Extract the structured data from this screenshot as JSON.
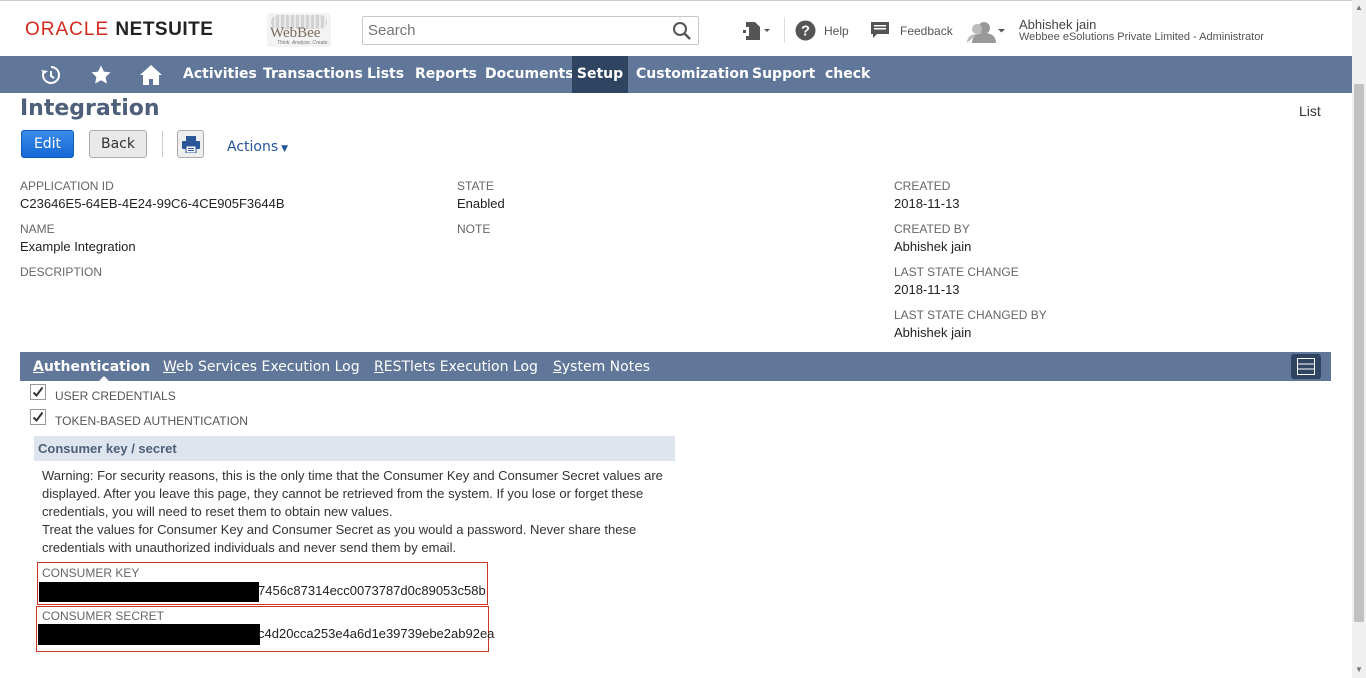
{
  "header": {
    "brand_left": "ORACLE",
    "brand_right": "NETSUITE",
    "partner_logo": "WebBee",
    "partner_tagline": "Think. Analyze. Create.",
    "search_placeholder": "Search",
    "help_label": "Help",
    "feedback_label": "Feedback",
    "user_name": "Abhishek jain",
    "user_org": "Webbee eSolutions Private Limited - Administrator"
  },
  "nav": {
    "items": [
      "Activities",
      "Transactions",
      "Lists",
      "Reports",
      "Documents",
      "Setup",
      "Customization",
      "Support",
      "check"
    ],
    "active": "Setup"
  },
  "page": {
    "title": "Integration",
    "list_link": "List",
    "edit_button": "Edit",
    "back_button": "Back",
    "actions_label": "Actions"
  },
  "fields": {
    "application_id_label": "APPLICATION ID",
    "application_id": "C23646E5-64EB-4E24-99C6-4CE905F3644B",
    "name_label": "NAME",
    "name": "Example Integration",
    "description_label": "DESCRIPTION",
    "state_label": "STATE",
    "state": "Enabled",
    "note_label": "NOTE",
    "created_label": "CREATED",
    "created": "2018-11-13",
    "created_by_label": "CREATED BY",
    "created_by": "Abhishek jain",
    "last_state_change_label": "LAST STATE CHANGE",
    "last_state_change": "2018-11-13",
    "last_state_changed_by_label": "LAST STATE CHANGED BY",
    "last_state_changed_by": "Abhishek jain"
  },
  "tabs": [
    {
      "label_first": "A",
      "label_rest": "uthentication",
      "active": true
    },
    {
      "label_first": "W",
      "label_rest": "eb Services Execution Log",
      "active": false
    },
    {
      "label_first": "R",
      "label_rest": "ESTlets Execution Log",
      "active": false
    },
    {
      "label_first": "S",
      "label_rest": "ystem Notes",
      "active": false
    }
  ],
  "auth": {
    "user_credentials_label": "USER CREDENTIALS",
    "user_credentials_checked": true,
    "token_auth_label": "TOKEN-BASED AUTHENTICATION",
    "token_auth_checked": true,
    "section_title": "Consumer key / secret",
    "warning_1": "Warning: For security reasons, this is the only time that the Consumer Key and Consumer Secret values are displayed. After you leave this page, they cannot be retrieved from the system. If you lose or forget these credentials, you will need to reset them to obtain new values.",
    "warning_2": "Treat the values for Consumer Key and Consumer Secret as you would a password. Never share these credentials with unauthorized individuals and never send them by email.",
    "consumer_key_label": "CONSUMER KEY",
    "consumer_key_visible": "7456c87314ecc0073787d0c89053c58b",
    "consumer_secret_label": "CONSUMER SECRET",
    "consumer_secret_visible": "c4d20cca253e4a6d1e39739ebe2ab92ea"
  },
  "colors": {
    "nav_bg": "#607799",
    "nav_active": "#2f4461",
    "edit_button": "#1467d6",
    "highlight_border": "#c8371e"
  }
}
